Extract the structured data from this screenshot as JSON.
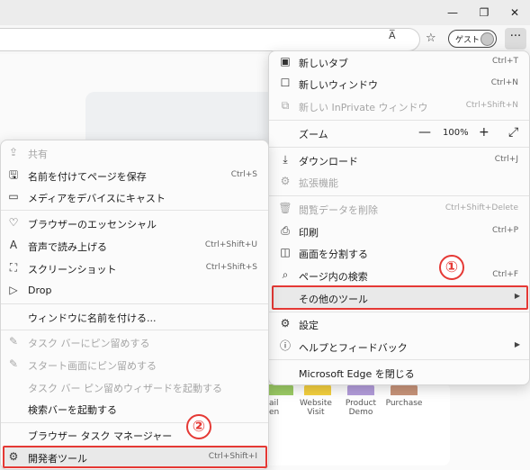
{
  "browser": {
    "read_aloud_label": "A̅",
    "guest_label": "ゲスト",
    "more_label": "···",
    "window_controls": [
      "minimize-icon",
      "restore-icon",
      "close-icon"
    ]
  },
  "background": {
    "labels": [
      "ail\nen",
      "Website\nVisit",
      "Product\nDemo",
      "Purchase"
    ],
    "bar_colors": [
      "#9ccc65",
      "#f4d03f",
      "#b39ddb",
      "#c8947a"
    ]
  },
  "main_menu": {
    "new_tab": {
      "label": "新しいタブ",
      "shortcut": "Ctrl+T"
    },
    "new_window": {
      "label": "新しいウィンドウ",
      "shortcut": "Ctrl+N"
    },
    "new_private": {
      "label": "新しい InPrivate ウィンドウ",
      "shortcut": "Ctrl+Shift+N"
    },
    "zoom": {
      "label": "ズーム",
      "minus": "—",
      "value": "100%",
      "plus": "+"
    },
    "downloads": {
      "label": "ダウンロード",
      "shortcut": "Ctrl+J"
    },
    "extensions": {
      "label": "拡張機能"
    },
    "clear_data": {
      "label": "閲覧データを削除",
      "shortcut": "Ctrl+Shift+Delete"
    },
    "print": {
      "label": "印刷",
      "shortcut": "Ctrl+P"
    },
    "split_screen": {
      "label": "画面を分割する"
    },
    "find": {
      "label": "ページ内の検索",
      "shortcut": "Ctrl+F"
    },
    "more_tools": {
      "label": "その他のツール"
    },
    "settings": {
      "label": "設定"
    },
    "help": {
      "label": "ヘルプとフィードバック"
    },
    "close_edge": {
      "label": "Microsoft Edge を閉じる"
    }
  },
  "sub_menu": {
    "share": {
      "label": "共有"
    },
    "save_as": {
      "label": "名前を付けてページを保存",
      "shortcut": "Ctrl+S"
    },
    "cast": {
      "label": "メディアをデバイスにキャスト"
    },
    "essentials": {
      "label": "ブラウザーのエッセンシャル"
    },
    "read_aloud": {
      "label": "音声で読み上げる",
      "shortcut": "Ctrl+Shift+U"
    },
    "screenshot": {
      "label": "スクリーンショット",
      "shortcut": "Ctrl+Shift+S"
    },
    "drop": {
      "label": "Drop"
    },
    "name_window": {
      "label": "ウィンドウに名前を付ける..."
    },
    "pin_taskbar": {
      "label": "タスク バーにピン留めする"
    },
    "pin_start": {
      "label": "スタート画面にピン留めする"
    },
    "pin_wizard": {
      "label": "タスク バー ピン留めウィザードを起動する"
    },
    "search_bar": {
      "label": "検索バーを起動する"
    },
    "task_manager": {
      "label": "ブラウザー タスク マネージャー"
    },
    "dev_tools": {
      "label": "開発者ツール",
      "shortcut": "Ctrl+Shift+I"
    }
  },
  "annotations": {
    "badge_1": "①",
    "badge_2": "②",
    "highlight_color": "#e53935"
  }
}
